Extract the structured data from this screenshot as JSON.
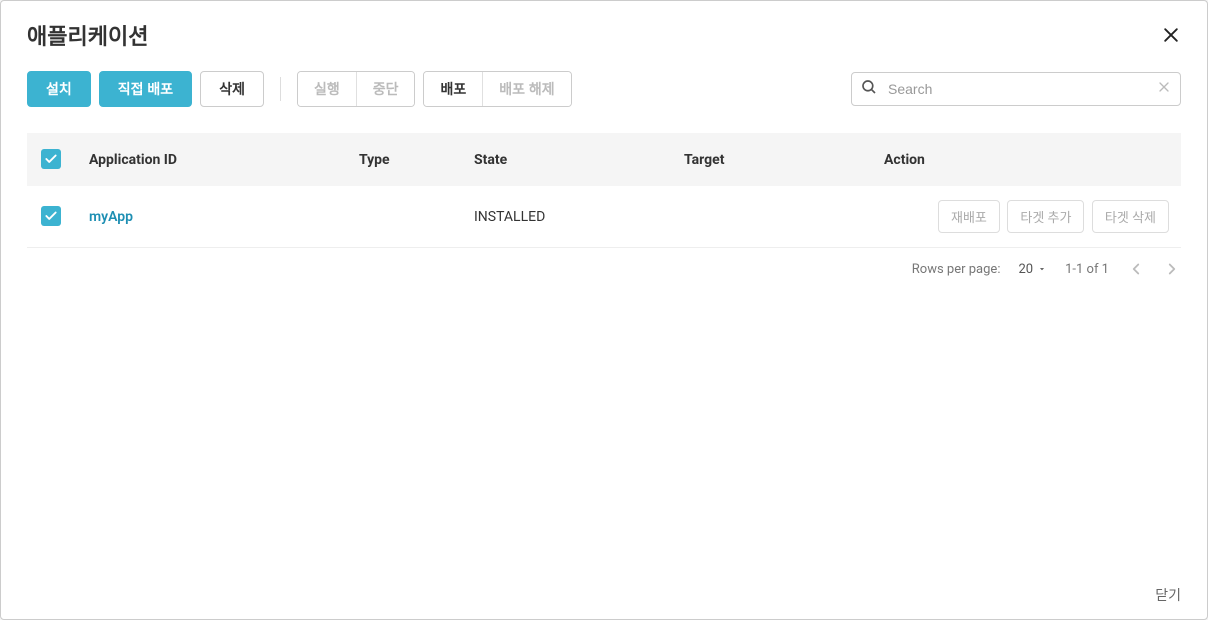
{
  "modal": {
    "title": "애플리케이션",
    "close_label": "닫기"
  },
  "toolbar": {
    "install": "설치",
    "direct_deploy": "직접 배포",
    "delete": "삭제",
    "run": "실행",
    "stop": "중단",
    "deploy": "배포",
    "undeploy": "배포 해제"
  },
  "search": {
    "placeholder": "Search"
  },
  "table": {
    "headers": {
      "app_id": "Application ID",
      "type": "Type",
      "state": "State",
      "target": "Target",
      "action": "Action"
    },
    "rows": [
      {
        "id": "myApp",
        "type": "",
        "state": "INSTALLED",
        "target": "",
        "actions": {
          "redeploy": "재배포",
          "add_target": "타겟 추가",
          "remove_target": "타겟 삭제"
        }
      }
    ]
  },
  "pagination": {
    "rows_label": "Rows per page:",
    "rows_value": "20",
    "range": "1-1 of 1"
  }
}
